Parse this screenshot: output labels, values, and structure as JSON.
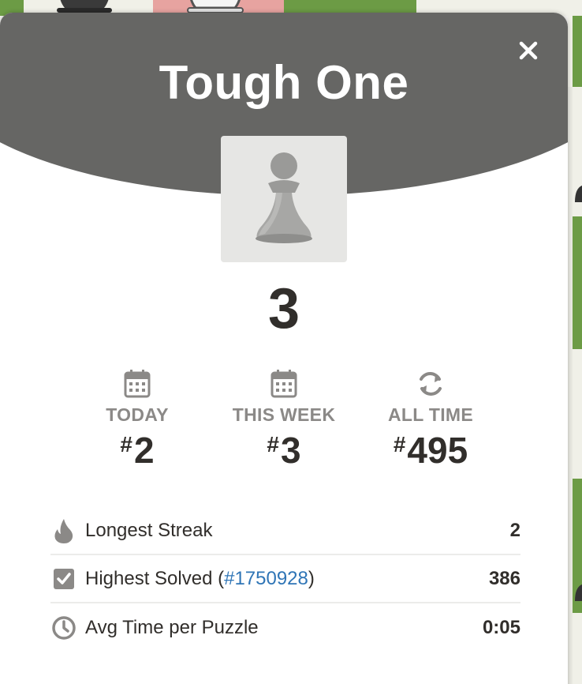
{
  "modal": {
    "title": "Tough One",
    "close_icon": "close-icon",
    "rank_icon": "pawn-icon",
    "score": "3"
  },
  "stats": [
    {
      "icon": "calendar-icon",
      "label": "TODAY",
      "hash": "#",
      "value": "2"
    },
    {
      "icon": "calendar-icon",
      "label": "THIS WEEK",
      "hash": "#",
      "value": "3"
    },
    {
      "icon": "refresh-icon",
      "label": "ALL TIME",
      "hash": "#",
      "value": "495"
    }
  ],
  "details": {
    "longest_streak": {
      "icon": "flame-icon",
      "label": "Longest Streak",
      "value": "2"
    },
    "highest_solved": {
      "icon": "checkbox-icon",
      "label_prefix": "Highest Solved (",
      "link": "#1750928",
      "label_suffix": ")",
      "value": "386"
    },
    "avg_time": {
      "icon": "clock-icon",
      "label": "Avg Time per Puzzle",
      "value": "0:05"
    }
  },
  "colors": {
    "header": "#666664",
    "board_green": "#6c9b45",
    "board_light": "#f0f0e8",
    "highlight": "#e7a3a0",
    "link": "#2f75b6",
    "text_dark": "#312e2b",
    "text_muted": "#8b8987"
  }
}
